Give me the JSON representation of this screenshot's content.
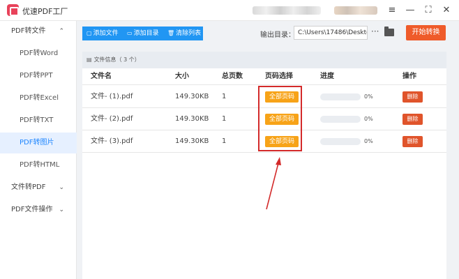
{
  "app": {
    "title": "优速PDF工厂"
  },
  "window_controls": {
    "menu": "≡",
    "minimize": "—",
    "restore": "⛶",
    "close": "✕"
  },
  "sidebar": {
    "items": [
      {
        "label": "PDF转文件",
        "chevron": "⌃",
        "kind": "group"
      },
      {
        "label": "PDF转Word",
        "kind": "sub"
      },
      {
        "label": "PDF转PPT",
        "kind": "sub"
      },
      {
        "label": "PDF转Excel",
        "kind": "sub"
      },
      {
        "label": "PDF转TXT",
        "kind": "sub"
      },
      {
        "label": "PDF转图片",
        "kind": "sub",
        "active": true
      },
      {
        "label": "PDF转HTML",
        "kind": "sub"
      },
      {
        "label": "文件转PDF",
        "chevron": "⌄",
        "kind": "group"
      },
      {
        "label": "PDF文件操作",
        "chevron": "⌄",
        "kind": "group"
      }
    ]
  },
  "toolbar": {
    "add_file": "添加文件",
    "add_dir": "添加目录",
    "clear_list": "清除列表",
    "output_label": "输出目录：",
    "output_path": "C:\\Users\\17486\\Deskto",
    "more": "···",
    "start": "开始转换"
  },
  "file_info": {
    "label": "文件信息",
    "count": "（ 3 个）"
  },
  "table": {
    "headers": {
      "name": "文件名",
      "size": "大小",
      "pages": "总页数",
      "page_select": "页码选择",
      "progress": "进度",
      "action": "操作"
    },
    "rows": [
      {
        "name": "文件- (1).pdf",
        "size": "149.30KB",
        "pages": "1",
        "page_select": "全部页码",
        "progress": 0,
        "progress_label": "0%",
        "action": "删除"
      },
      {
        "name": "文件- (2).pdf",
        "size": "149.30KB",
        "pages": "1",
        "page_select": "全部页码",
        "progress": 0,
        "progress_label": "0%",
        "action": "删除"
      },
      {
        "name": "文件- (3).pdf",
        "size": "149.30KB",
        "pages": "1",
        "page_select": "全部页码",
        "progress": 0,
        "progress_label": "0%",
        "action": "删除"
      }
    ]
  },
  "colors": {
    "accent": "#2196f3",
    "start": "#ef5b2a",
    "page_button": "#f7a318",
    "delete_button": "#e0542b",
    "annotation": "#d32a2a"
  },
  "icons": {
    "add_file": "file-plus-icon",
    "add_dir": "folder-icon",
    "clear_list": "trash-icon",
    "file_info": "document-icon",
    "output_folder": "folder-icon"
  }
}
